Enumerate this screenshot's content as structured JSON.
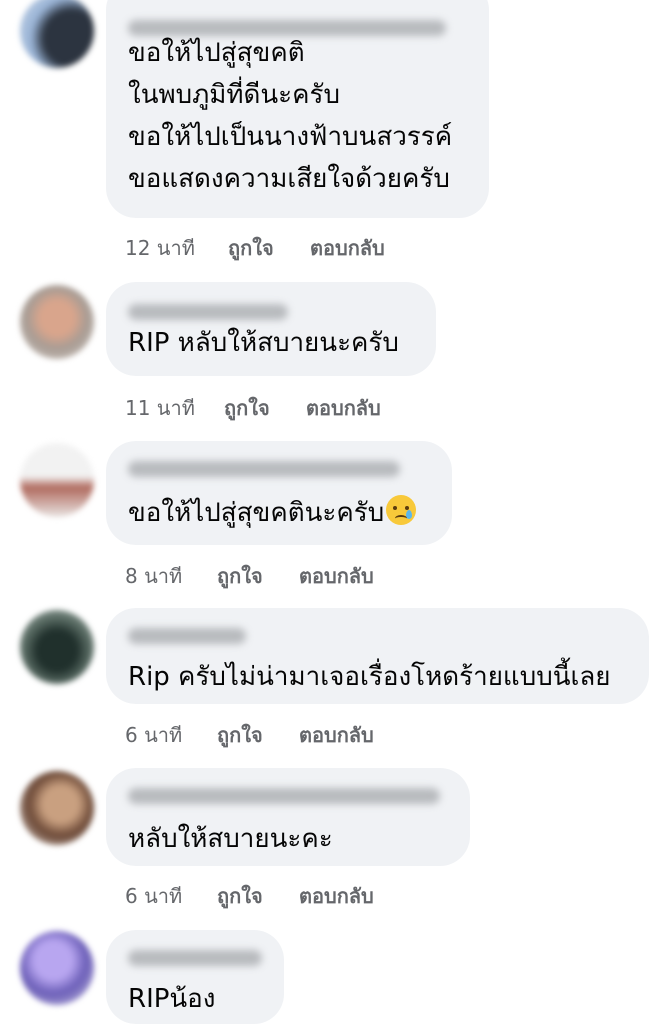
{
  "comments": [
    {
      "lines": [
        "ขอให้ไปสู่สุขคติ",
        "ในพบภูมิที่ดีนะครับ",
        "ขอให้ไปเป็นนางฟ้าบนสวรรค์",
        "ขอแสดงความเสียใจด้วยครับ"
      ],
      "time": "12 นาที",
      "like": "ถูกใจ",
      "reply": "ตอบกลับ"
    },
    {
      "lines": [
        "RIP หลับให้สบายนะครับ"
      ],
      "time": "11 นาที",
      "like": "ถูกใจ",
      "reply": "ตอบกลับ"
    },
    {
      "lines": [
        "ขอให้ไปสู่สุขคตินะครับ"
      ],
      "emoji": "crying-face-emoji",
      "time": "8 นาที",
      "like": "ถูกใจ",
      "reply": "ตอบกลับ"
    },
    {
      "lines": [
        "Rip ครับไม่น่ามาเจอเรื่องโหดร้ายแบบนี้เลย"
      ],
      "time": "6 นาที",
      "like": "ถูกใจ",
      "reply": "ตอบกลับ"
    },
    {
      "lines": [
        "หลับให้สบายนะคะ"
      ],
      "time": "6 นาที",
      "like": "ถูกใจ",
      "reply": "ตอบกลับ"
    },
    {
      "lines": [
        "RIPน้อง"
      ]
    }
  ],
  "colors": {
    "bubble": "#f0f2f5",
    "text": "#050505",
    "meta": "#65676b"
  }
}
